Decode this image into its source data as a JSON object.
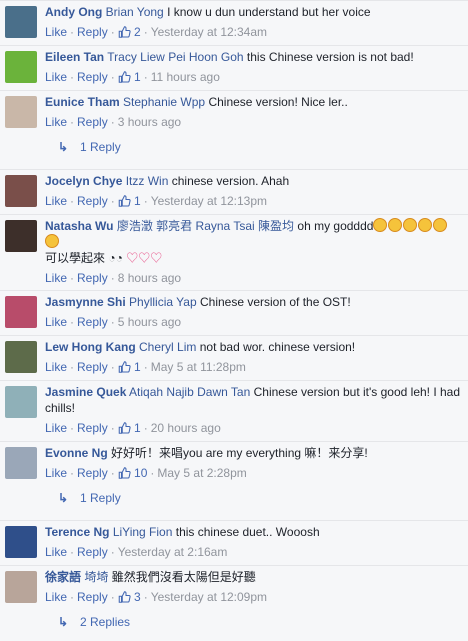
{
  "actions": {
    "like": "Like",
    "reply": "Reply"
  },
  "comments": [
    {
      "author": "Andy Ong",
      "tags": [
        "Brian Yong"
      ],
      "text": "I know u dun understand but her voice",
      "likes": "2",
      "time": "Yesterday at 12:34am",
      "avatar_color": "#4a6f8a"
    },
    {
      "author": "Eileen Tan",
      "tags": [
        "Tracy Liew",
        "Pei Hoon Goh"
      ],
      "text": "this Chinese version is not bad!",
      "likes": "1",
      "time": "11 hours ago",
      "avatar_color": "#6bb33b"
    },
    {
      "author": "Eunice Tham",
      "tags": [
        "Stephanie Wpp"
      ],
      "text": "Chinese version! Nice ler..",
      "time": "3 hours ago",
      "avatar_color": "#c9b7a8",
      "replies": "1 Reply"
    },
    {
      "author": "Jocelyn Chye",
      "tags": [
        "Itzz Win"
      ],
      "text": "chinese version. Ahah",
      "likes": "1",
      "time": "Yesterday at 12:13pm",
      "avatar_color": "#7a4f4a"
    },
    {
      "author": "Natasha Wu",
      "tags": [
        "廖浩澂",
        "郭亮君",
        "Rayna Tsai",
        "陳盈均"
      ],
      "text": "oh my godddd",
      "line2": "可以學起來",
      "time": "8 hours ago",
      "avatar_color": "#3d2f2a"
    },
    {
      "author": "Jasmynne Shi",
      "tags": [
        "Phyllicia Yap"
      ],
      "text": "Chinese version of the OST!",
      "time": "5 hours ago",
      "avatar_color": "#b84c6a"
    },
    {
      "author": "Lew Hong Kang",
      "tags": [
        "Cheryl Lim"
      ],
      "text": "not bad wor. chinese version!",
      "likes": "1",
      "time": "May 5 at 11:28pm",
      "avatar_color": "#5d6b4a"
    },
    {
      "author": "Jasmine Quek",
      "tags": [
        "Atiqah Najib",
        "Dawn Tan"
      ],
      "text": "Chinese version but it's good leh! I had chills!",
      "likes": "1",
      "time": "20 hours ago",
      "avatar_color": "#8fb0b8"
    },
    {
      "author": "Evonne Ng",
      "tags": [],
      "text": "好好听！来唱you are my everything 嘛！来分享!",
      "likes": "10",
      "time": "May 5 at 2:28pm",
      "avatar_color": "#9aa7b8",
      "replies": "1 Reply"
    },
    {
      "author": "Terence Ng",
      "tags": [
        "LiYing Fion"
      ],
      "text": "this chinese duet.. Wooosh",
      "time": "Yesterday at 2:16am",
      "avatar_color": "#2f4f8a"
    },
    {
      "author": "徐家語",
      "tags": [
        "埼埼"
      ],
      "text": "雖然我們沒看太陽但是好聽",
      "likes": "3",
      "time": "Yesterday at 12:09pm",
      "avatar_color": "#b8a59a",
      "replies": "2 Replies"
    }
  ]
}
